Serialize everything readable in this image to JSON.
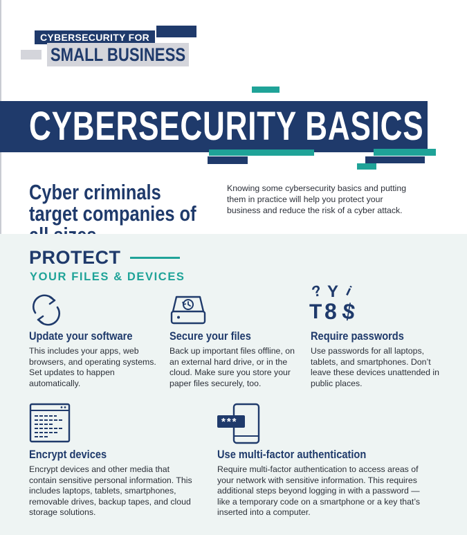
{
  "series": {
    "line1": "CYBERSECURITY FOR",
    "line2": "SMALL BUSINESS"
  },
  "banner": {
    "title": "CYBERSECURITY BASICS"
  },
  "intro": {
    "headline": "Cyber criminals target companies of all sizes.",
    "text": "Knowing some cybersecurity basics and putting them in practice will help you protect your business and reduce the risk of a cyber attack."
  },
  "protect": {
    "title": "PROTECT",
    "subtitle": "YOUR FILES & DEVICES",
    "cards": [
      {
        "icon": "refresh-icon",
        "title": "Update your software",
        "text": "This includes your apps, web browsers, and operating systems. Set updates to happen automatically."
      },
      {
        "icon": "backup-drive-icon",
        "title": "Secure your files",
        "text": "Back up important files offline, on an external hard drive, or in the cloud. Make sure you store your paper files securely, too."
      },
      {
        "icon": "password-characters-icon",
        "title": "Require passwords",
        "text": "Use passwords for all laptops, tablets, and smartphones. Don’t leave these devices unattended in public places."
      },
      {
        "icon": "encrypted-document-icon",
        "title": "Encrypt devices",
        "text": "Encrypt devices and other media that contain sensitive personal information. This includes laptops, tablets, smartphones, removable drives, backup tapes, and cloud storage solutions."
      },
      {
        "icon": "phone-code-icon",
        "title": "Use multi-factor authentication",
        "text": "Require multi-factor authentication to access areas of your network with sensitive information. This requires additional steps beyond logging in with a password — like a temporary code on a smartphone or a key that’s inserted into a computer."
      }
    ],
    "password_glyphs": [
      "?",
      "Y",
      "i",
      "T",
      "8",
      "$"
    ],
    "masked_code": "***"
  },
  "colors": {
    "navy": "#1f3a6b",
    "teal": "#1fa398",
    "panel": "#eef4f3",
    "gray": "#d4d5db"
  }
}
